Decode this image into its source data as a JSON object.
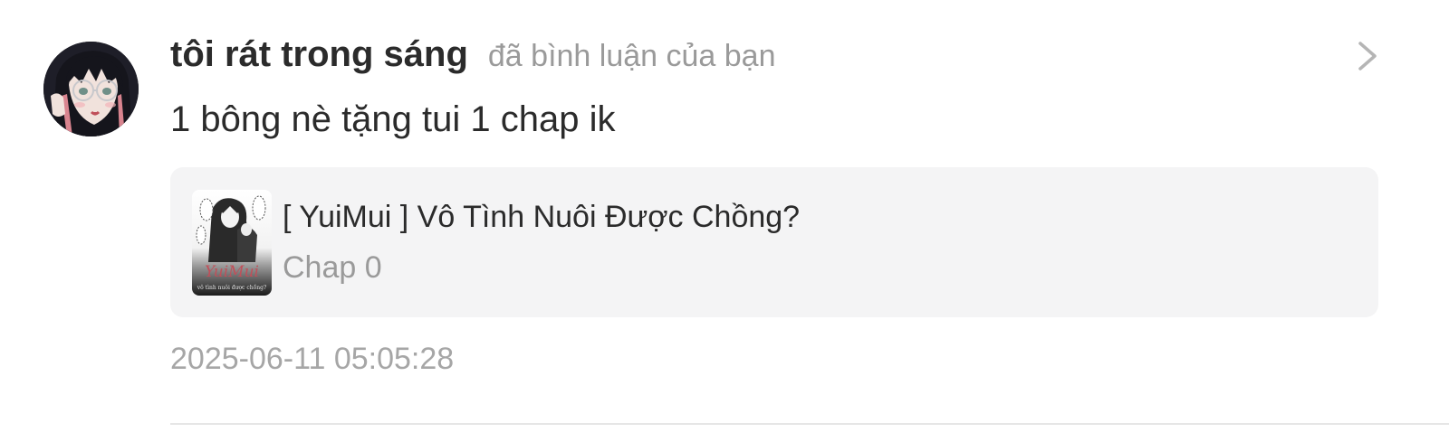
{
  "notification": {
    "username": "tôi rát trong sáng",
    "action": "đã bình luận của bạn",
    "comment": "1 bông nè tặng tui 1 chap ik",
    "timestamp": "2025-06-11 05:05:28",
    "avatar_icon": "user-avatar",
    "chevron_icon": "chevron-right-icon"
  },
  "work": {
    "title": "[ YuiMui ] Vô Tình Nuôi Được Chồng?",
    "chapter": "Chap 0",
    "cover_logo_text": "YuiMui",
    "cover_caption": "vô tình nuôi được chồng?"
  },
  "colors": {
    "username": "#2b2b2b",
    "secondary_text": "#9a9a9a",
    "card_background": "#f4f4f5",
    "divider": "#e6e6e6",
    "cover_logo": "#c0505a"
  }
}
